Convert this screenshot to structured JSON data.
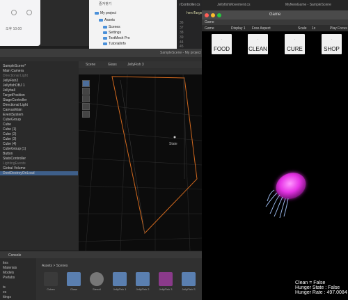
{
  "notes": {
    "time": "오후 10:00"
  },
  "finder": {
    "title": "즐겨찾기",
    "items": [
      {
        "label": "My project",
        "num": ""
      },
      {
        "label": "Assets",
        "num": ""
      },
      {
        "label": "Scenes",
        "num": ""
      },
      {
        "label": "Settings",
        "num": ""
      },
      {
        "label": "TextMesh Pro",
        "num": ""
      },
      {
        "label": "TutorialInfo",
        "num": ""
      }
    ]
  },
  "editor": {
    "tab": "rController.cs",
    "lines": [
      "36",
      "37",
      "38",
      "39",
      "44",
      "45",
      "46"
    ],
    "code_hint": "heroTarge"
  },
  "top_strip": {
    "tab1": "JellyfishMovement.cs",
    "tab2": "MyNewGame - SampleScene"
  },
  "unity": {
    "window_title": "SampleScene - My project",
    "hierarchy": {
      "items": [
        {
          "label": "SampleScene*",
          "state": "normal"
        },
        {
          "label": "Main Camera",
          "state": "normal"
        },
        {
          "label": "Directional Light",
          "state": "dim"
        },
        {
          "label": "JellyFish2",
          "state": "normal"
        },
        {
          "label": "JellyfishOBJ 1",
          "state": "normal"
        },
        {
          "label": "Jellyball",
          "state": "normal"
        },
        {
          "label": "TargetPosition",
          "state": "normal"
        },
        {
          "label": "StageController",
          "state": "normal"
        },
        {
          "label": "Directional Light",
          "state": "normal"
        },
        {
          "label": "CanvasMain",
          "state": "normal"
        },
        {
          "label": "EventSystem",
          "state": "normal"
        },
        {
          "label": "CubeGroup",
          "state": "normal"
        },
        {
          "label": "Cube",
          "state": "normal"
        },
        {
          "label": "Cube (1)",
          "state": "normal"
        },
        {
          "label": "Cube (2)",
          "state": "normal"
        },
        {
          "label": "Cube (3)",
          "state": "normal"
        },
        {
          "label": "Cube (4)",
          "state": "normal"
        },
        {
          "label": "CubeGroup (1)",
          "state": "normal"
        },
        {
          "label": "Button",
          "state": "normal"
        },
        {
          "label": "StatsController",
          "state": "normal"
        },
        {
          "label": "LightingEvents",
          "state": "dim"
        },
        {
          "label": "Global Volume",
          "state": "normal"
        },
        {
          "label": "DontDestroyOnLoad",
          "state": "selected"
        }
      ]
    },
    "scene_tabs": {
      "scene": "Scene",
      "glass": "Glass",
      "jellyfish": "JellyFish 3"
    },
    "scene_label": "State",
    "console_tab": "Console",
    "project": {
      "left_items": [
        "ites",
        "Materials",
        "Models",
        "Prefabs",
        "",
        "ts",
        "es",
        "ttings"
      ],
      "breadcrumb": "Assets > Scenes",
      "assets": [
        "Cubes",
        "Glass",
        "Stencil",
        "JellyFish 1",
        "JellyFish 2",
        "JellyFish 3",
        "JellyFish S"
      ]
    }
  },
  "game": {
    "title": "Game",
    "tab": "Game",
    "toolbar": {
      "mode": "Game",
      "display": "Display 1",
      "aspect": "Free Aspect",
      "scale": "Scale",
      "scale_value": "1x",
      "play": "Play Focus"
    },
    "buttons": [
      {
        "label": "FOOD",
        "top": "-"
      },
      {
        "label": "CLEAN",
        "top": "-"
      },
      {
        "label": "CURE",
        "top": "-"
      },
      {
        "label": "SHOP",
        "top": "-"
      }
    ],
    "status_lines": [
      "Clean = False",
      "Hunger State : False",
      "Hunger Rate : 497.0084"
    ]
  },
  "colors": {
    "jellyfish": "#ff4dff",
    "tentacles": "#a8c8ff",
    "selection": "#3e5f8a",
    "game_bg": "#000000"
  }
}
